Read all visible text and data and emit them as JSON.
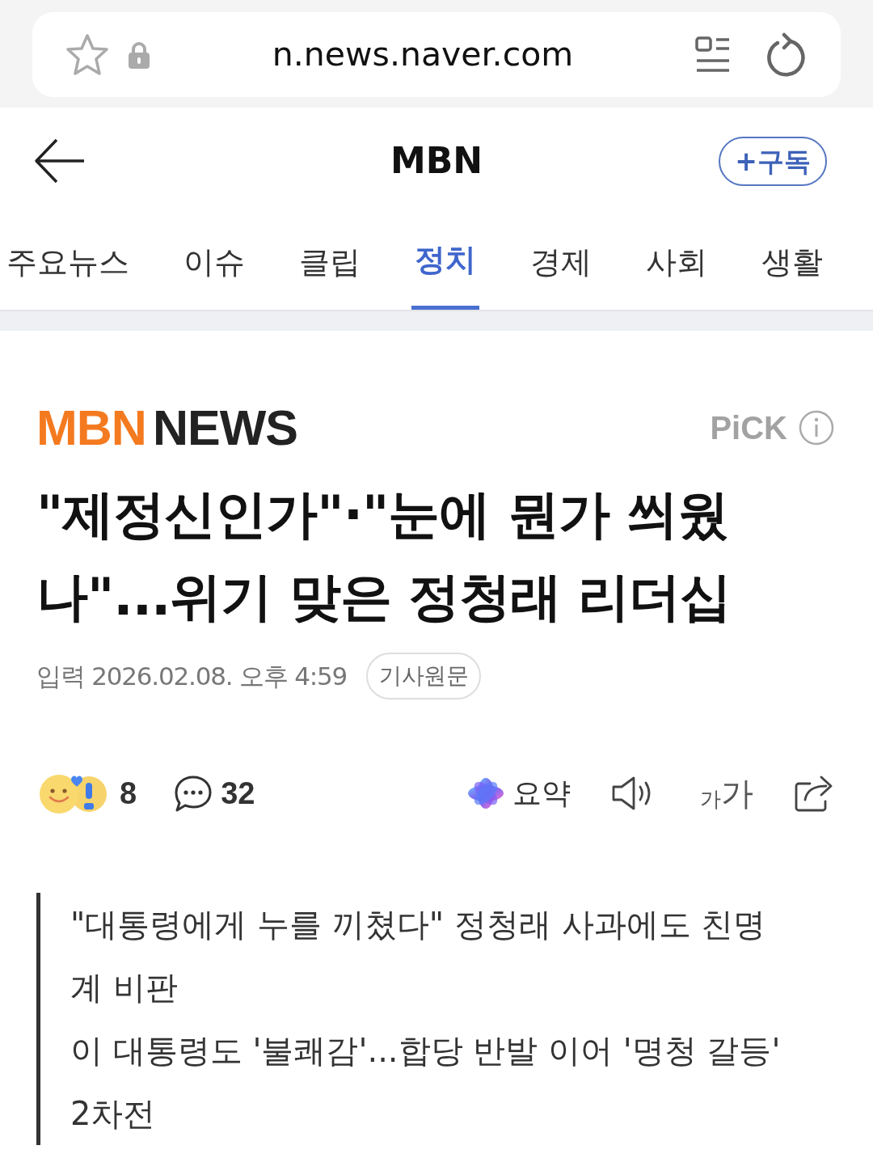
{
  "browser_bar": {
    "url": "n.news.naver.com"
  },
  "header": {
    "title": "MBN",
    "subscribe_button": "+구독"
  },
  "tabs": [
    {
      "label": "주요뉴스",
      "selected": false
    },
    {
      "label": "이슈",
      "selected": false
    },
    {
      "label": "클립",
      "selected": false
    },
    {
      "label": "정치",
      "selected": true
    },
    {
      "label": "경제",
      "selected": false
    },
    {
      "label": "사회",
      "selected": false
    },
    {
      "label": "생활",
      "selected": false
    }
  ],
  "article": {
    "press_logo": {
      "part_1": "MBN",
      "part_2": "NEWS"
    },
    "pick_label": "PiCK",
    "headline": "\"제정신인가\"·\"눈에 뭔가 씌웠나\"...위기 맞은 정청래 리더십",
    "published": "입력 2026.02.08. 오후 4:59",
    "original_link": "기사원문"
  },
  "actions": {
    "reaction_count": "8",
    "comment_count": "32",
    "summary_label": "요약",
    "font_size_small": "가",
    "font_size_large": "가"
  },
  "related": [
    "\"대통령에게 누를 끼쳤다\" 정청래 사과에도 친명계 비판",
    "이 대통령도 '불쾌감'...합당 반발 이어 '명청 갈등' 2차전"
  ]
}
